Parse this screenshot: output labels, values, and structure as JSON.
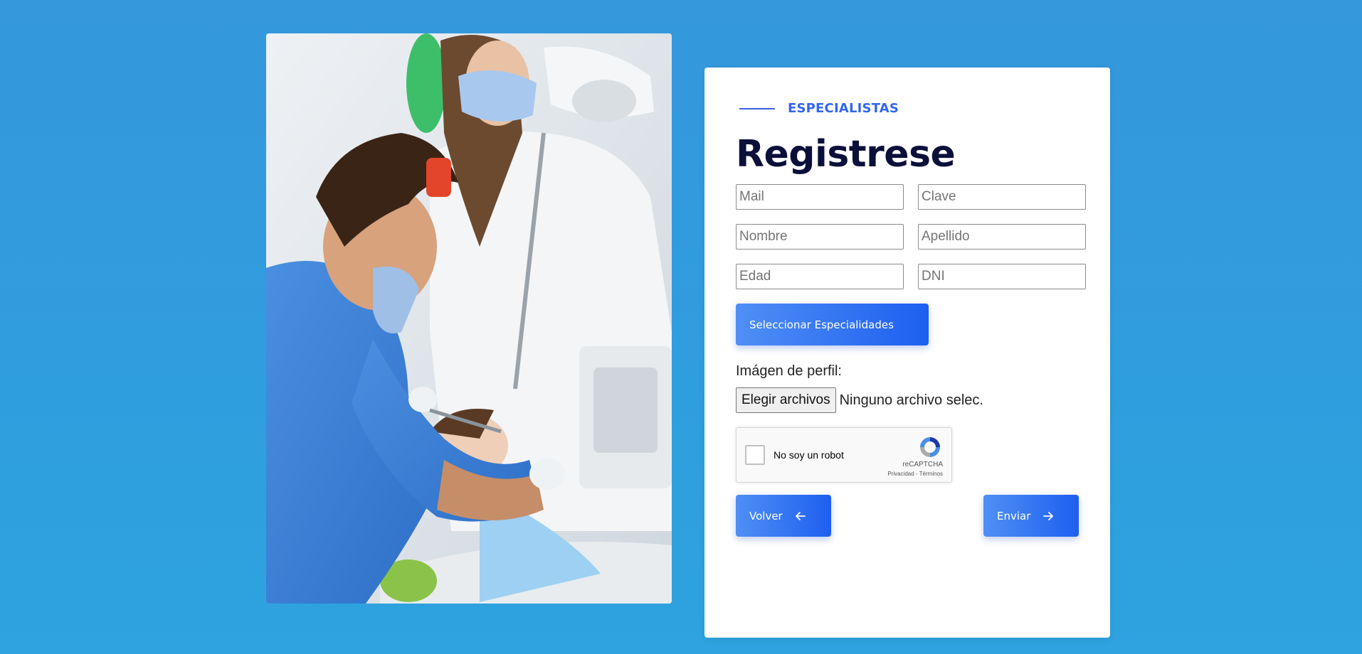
{
  "hero": {
    "image_name": "dentist-treating-patient-photo"
  },
  "form": {
    "eyebrow": "ESPECIALISTAS",
    "title": "Registrese",
    "fields": {
      "mail_placeholder": "Mail",
      "clave_placeholder": "Clave",
      "nombre_placeholder": "Nombre",
      "apellido_placeholder": "Apellido",
      "edad_placeholder": "Edad",
      "dni_placeholder": "DNI"
    },
    "especialidades_button": "Seleccionar Especialidades",
    "profile_image_label": "Imágen de perfil:",
    "file_button": "Elegir archivos",
    "file_status": "Ninguno archivo selec.",
    "captcha": {
      "label": "No soy un robot",
      "brand": "reCAPTCHA",
      "privacy": "Privacidad",
      "terms": "Términos",
      "separator": " - "
    },
    "back_button": "Volver",
    "submit_button": "Enviar"
  },
  "colors": {
    "background": "#3198dc",
    "accent": "#3366ee",
    "title": "#0b0f3a",
    "button_start": "#4f8ff5",
    "button_end": "#1e5ff0"
  }
}
